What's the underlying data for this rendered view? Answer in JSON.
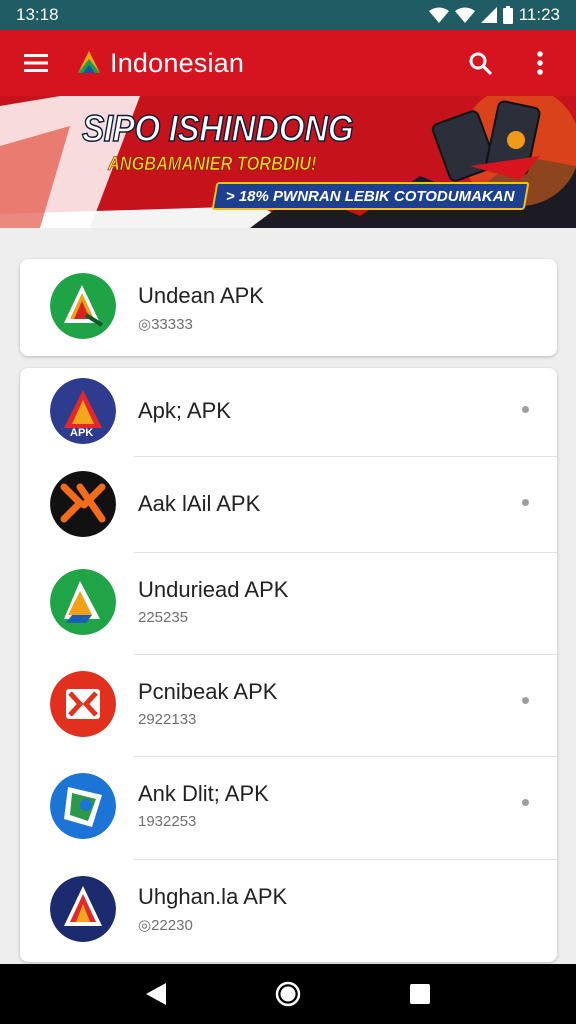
{
  "status_bar": {
    "time_left": "13:18",
    "time_right": "11:23"
  },
  "app_bar": {
    "title": "Indonesian",
    "icons": [
      "menu-icon",
      "search-icon",
      "more-vert-icon"
    ]
  },
  "banner": {
    "headline": "SIPO ISHINDONG",
    "subheadline": "ANGBAMANIER TORBDIU!",
    "cta": "> 18% PWNRAN LEBIK COTODUMAKAN"
  },
  "featured": {
    "title": "Undean APK",
    "sub": "◎33333"
  },
  "apps": [
    {
      "title": "Apk; APK",
      "sub": "",
      "has_dot": true
    },
    {
      "title": "Aak lAil APK",
      "sub": "",
      "has_dot": true
    },
    {
      "title": "Unduriead APK",
      "sub": "225235",
      "has_dot": false
    },
    {
      "title": "Pcnibeak APK",
      "sub": "2922133",
      "has_dot": true
    },
    {
      "title": "Ank Dlit; APK",
      "sub": "1932253",
      "has_dot": true
    },
    {
      "title": "Uhghan.la APK",
      "sub": "◎22230",
      "has_dot": false
    }
  ],
  "colors": {
    "status_bar": "#1f5c64",
    "app_bar": "#d6141f",
    "nav_bar": "#000000",
    "card_bg": "#ffffff",
    "page_bg": "#eeeeee"
  }
}
